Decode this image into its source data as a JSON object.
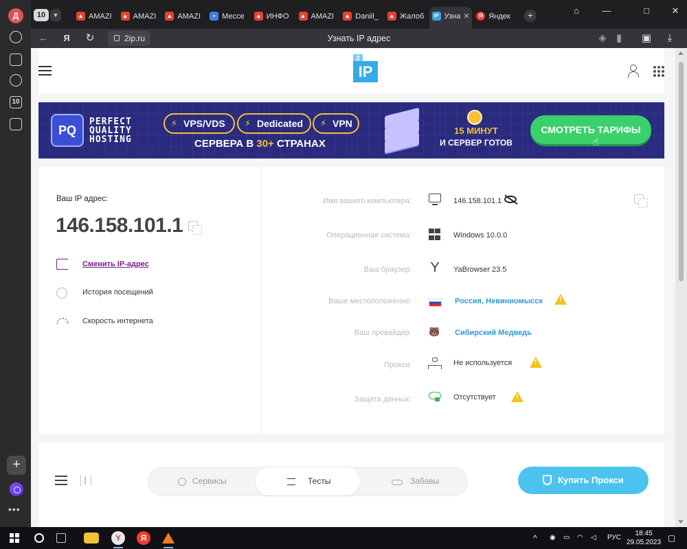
{
  "browser": {
    "profile_initial": "Д",
    "tab_count": "10",
    "tabs": [
      {
        "label": "AMAZI",
        "favicon": "amazon-icon"
      },
      {
        "label": "AMAZI",
        "favicon": "amazon-icon"
      },
      {
        "label": "AMAZI",
        "favicon": "amazon-icon"
      },
      {
        "label": "Мессе",
        "favicon": "messenger-icon"
      },
      {
        "label": "ИНФО",
        "favicon": "amazon-icon"
      },
      {
        "label": "AMAZI",
        "favicon": "amazon-icon"
      },
      {
        "label": "Daniil_",
        "favicon": "amazon-icon"
      },
      {
        "label": "Жалоб",
        "favicon": "amazon-icon"
      },
      {
        "label": "Узна",
        "favicon": "2ip-icon",
        "active": true
      },
      {
        "label": "Яндек",
        "favicon": "yandex-icon"
      }
    ],
    "address": "2ip.ru",
    "page_title": "Узнать IP адрес",
    "rail_badge": "10"
  },
  "site": {
    "logo_small": "2",
    "logo_main": "IP"
  },
  "banner": {
    "brand_lines": [
      "PERFECT",
      "QUALITY",
      "HOSTING"
    ],
    "pills": [
      "VPS/VDS",
      "Dedicated",
      "VPN"
    ],
    "servers_prefix": "СЕРВЕРА В ",
    "servers_highlight": "30+",
    "servers_suffix": " СТРАНАХ",
    "minutes": "15 МИНУТ",
    "ready": "И СЕРВЕР ГОТОВ",
    "cta": "СМОТРЕТЬ ТАРИФЫ",
    "accent": "#f5c23a",
    "bg": "#2a2a7e"
  },
  "ip_card": {
    "label": "Ваш IP адрес:",
    "ip": "146.158.101.1",
    "links": [
      {
        "label": "Сменить IP-адрес",
        "icon": "change-ip-icon",
        "active": true
      },
      {
        "label": "История посещений",
        "icon": "history-icon"
      },
      {
        "label": "Скорость интернета",
        "icon": "speed-icon"
      }
    ]
  },
  "details": {
    "rows": [
      {
        "label": "Имя вашего компьютера:",
        "value": "146.158.101.1",
        "icon": "monitor-icon"
      },
      {
        "label": "Операционная система:",
        "value": "Windows 10.0.0",
        "icon": "windows-icon"
      },
      {
        "label": "Ваш браузер:",
        "value": "YaBrowser 23.5",
        "icon": "yandex-browser-icon"
      },
      {
        "label": "Ваше местоположение:",
        "value": "Россия, Невинномысск",
        "icon": "russia-flag-icon",
        "link": true,
        "warning": true
      },
      {
        "label": "Ваш провайдер:",
        "value": "Сибирский Медведь",
        "icon": "bear-icon",
        "link": true
      },
      {
        "label": "Прокси:",
        "value": "Не используется",
        "icon": "proxy-network-icon",
        "warning": true
      },
      {
        "label": "Защита данных:",
        "value": "Отсутствует",
        "icon": "cloud-lock-icon",
        "warning": true
      }
    ],
    "link_color": "#2d9ad8",
    "warning_color": "#f0c419"
  },
  "bottom_nav": {
    "segments": [
      {
        "label": "Сервисы",
        "icon": "globe-icon"
      },
      {
        "label": "Тесты",
        "icon": "tests-icon",
        "active": true
      },
      {
        "label": "Забавы",
        "icon": "bike-icon"
      }
    ],
    "buy_button": "Купить Прокси"
  },
  "taskbar": {
    "language": "РУС",
    "time": "18:45",
    "date": "29.05.2023"
  }
}
